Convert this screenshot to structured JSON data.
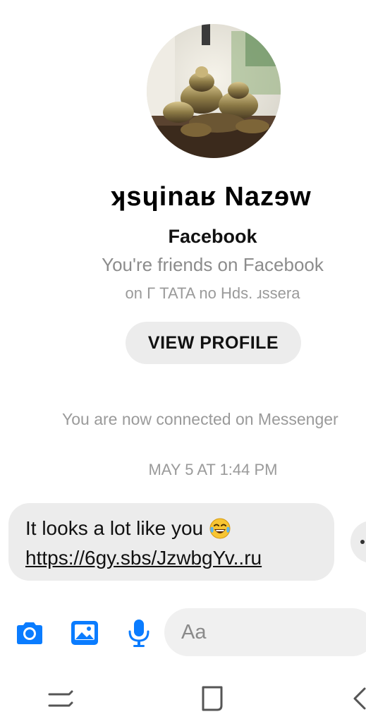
{
  "profile": {
    "name": "ʞsɥinaʁ Nazɘw",
    "platform": "Facebook",
    "friends_text": "You're friends on Facebook",
    "meta_text": "on Г TATA no Hds. ɹssera",
    "view_profile_label": "VIEW PROFILE"
  },
  "thread": {
    "connected_text": "You are now connected on Messenger",
    "timestamp": "MAY 5 AT 1:44 PM",
    "message": {
      "text": "It looks a lot like you",
      "emoji": "face-with-tears-of-joy",
      "link": "https://6gy.sbs/JzwbgYv..ru"
    }
  },
  "composer": {
    "placeholder": "Aa",
    "icons": [
      "camera-icon",
      "gallery-icon",
      "microphone-icon"
    ],
    "accent_color": "#0a7cff"
  },
  "nav": {
    "icons": [
      "recent-apps-icon",
      "home-icon",
      "back-icon"
    ]
  }
}
